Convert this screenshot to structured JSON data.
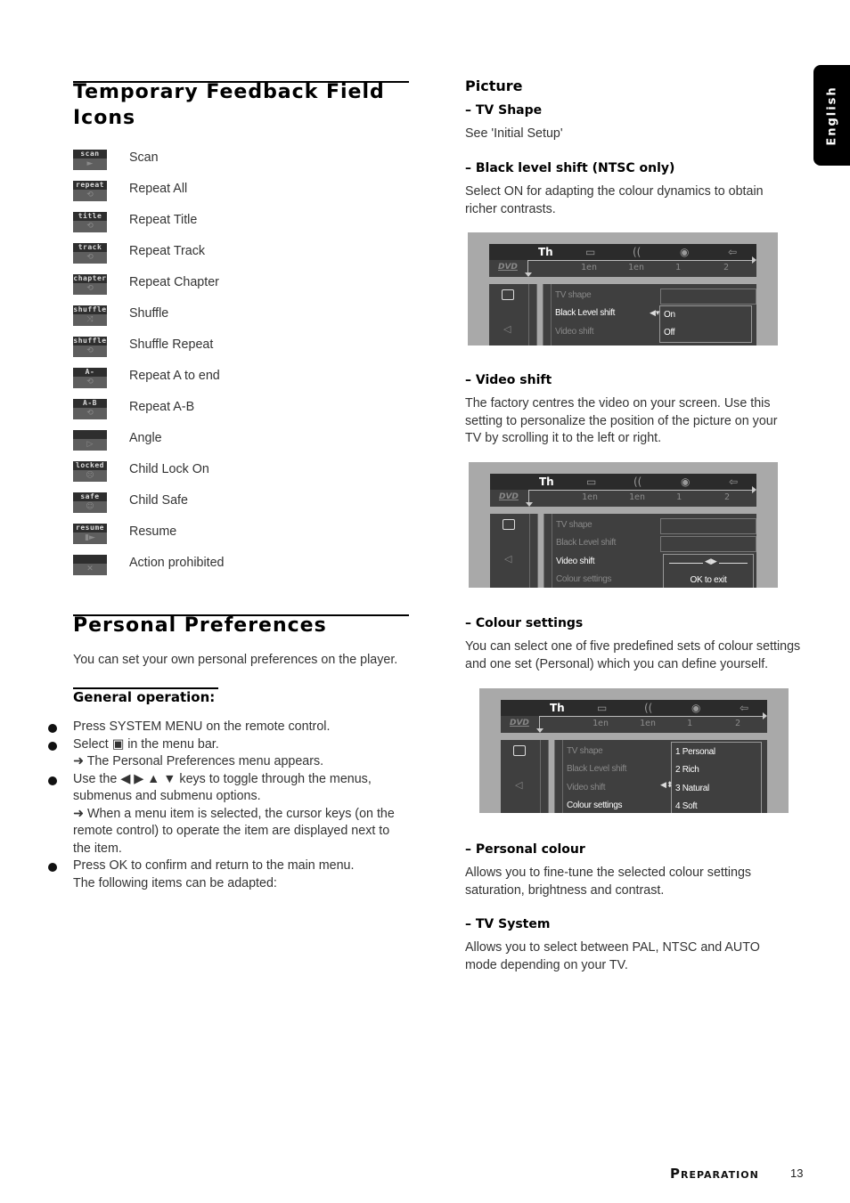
{
  "lang_tab": "English",
  "feedback": {
    "title": "Temporary Feedback Field Icons",
    "items": [
      {
        "tag": "scan",
        "glyph": "►",
        "label": "Scan"
      },
      {
        "tag": "repeat",
        "glyph": "⟲",
        "label": "Repeat All"
      },
      {
        "tag": "title",
        "glyph": "⟲",
        "label": "Repeat Title"
      },
      {
        "tag": "track",
        "glyph": "⟲",
        "label": "Repeat Track"
      },
      {
        "tag": "chapter",
        "glyph": "⟲",
        "label": "Repeat Chapter"
      },
      {
        "tag": "shuffle",
        "glyph": "⤨",
        "label": "Shuffle"
      },
      {
        "tag": "shuffle",
        "glyph": "⟲",
        "label": "Shuffle Repeat"
      },
      {
        "tag": "A-",
        "glyph": "⟲",
        "label": "Repeat A to end"
      },
      {
        "tag": "A-B",
        "glyph": "⟲",
        "label": "Repeat A-B"
      },
      {
        "tag": "",
        "glyph": "▷",
        "label": "Angle"
      },
      {
        "tag": "locked",
        "glyph": "☹",
        "label": "Child Lock On"
      },
      {
        "tag": "safe",
        "glyph": "☺",
        "label": "Child Safe"
      },
      {
        "tag": "resume",
        "glyph": "▮►",
        "label": "Resume"
      },
      {
        "tag": "",
        "glyph": "✕",
        "label": "Action prohibited"
      }
    ]
  },
  "prefs": {
    "title": "Personal Preferences",
    "intro": "You can set your own personal preferences on the player.",
    "general_heading": "General operation:",
    "bullets": [
      {
        "lines": [
          "Press SYSTEM MENU on the remote control."
        ]
      },
      {
        "lines": [
          "Select ▣ in the menu bar.",
          "➜ The Personal Preferences menu appears."
        ]
      },
      {
        "lines": [
          "Use the ◀ ▶ ▲ ▼ keys to toggle through the menus,",
          "submenus and submenu options.",
          "➜ When a menu item is selected, the cursor keys (on the",
          "remote control) to operate the item are displayed next to",
          "the item."
        ]
      },
      {
        "lines": [
          "Press OK to confirm and return to the main menu.",
          "The following items can be adapted:"
        ]
      }
    ]
  },
  "picture": {
    "heading": "Picture",
    "sections": [
      {
        "title": "–  TV Shape",
        "text": [
          "See 'Initial Setup'"
        ]
      },
      {
        "title": "–  Black level shift (NTSC only)",
        "text": [
          "Select ON for adapting the colour dynamics to obtain",
          "richer contrasts."
        ]
      },
      {
        "title": "–  Video shift",
        "text": [
          "The factory centres the video on your screen. Use this",
          "setting to personalize the position of the picture on your",
          "TV by scrolling it to the left or right."
        ]
      },
      {
        "title": "–  Colour settings",
        "text": [
          "You can select one of five predefined sets of colour settings",
          "and one set (Personal) which you can define yourself."
        ]
      },
      {
        "title": "–  Personal colour",
        "text": [
          "Allows you to fine-tune the selected colour settings",
          "saturation, brightness and contrast."
        ]
      },
      {
        "title": "–  TV System",
        "text": [
          "Allows you to select between PAL, NTSC and AUTO",
          "mode depending on your TV."
        ]
      }
    ]
  },
  "osd": {
    "menu_icons": [
      "preferences-icon",
      "subtitle-icon",
      "audio-icon",
      "angle-icon",
      "exit-icon"
    ],
    "menu_icon_glyphs": [
      "Th",
      "▭",
      "((",
      "◉",
      "⇦"
    ],
    "dvd_label": "DVD",
    "menu_values": [
      "1en",
      "1en",
      "1",
      "2"
    ],
    "items": [
      "TV shape",
      "Black Level shift",
      "Video shift",
      "Colour settings"
    ],
    "screen1": {
      "options": [
        "On",
        "Off"
      ]
    },
    "screen2": {
      "exit": "OK to exit",
      "slider": "◀▶"
    },
    "screen3": {
      "options": [
        "1 Personal",
        "2 Rich",
        "3 Natural",
        "4 Soft"
      ]
    }
  },
  "footer": {
    "section": "Preparation",
    "page": "13"
  }
}
